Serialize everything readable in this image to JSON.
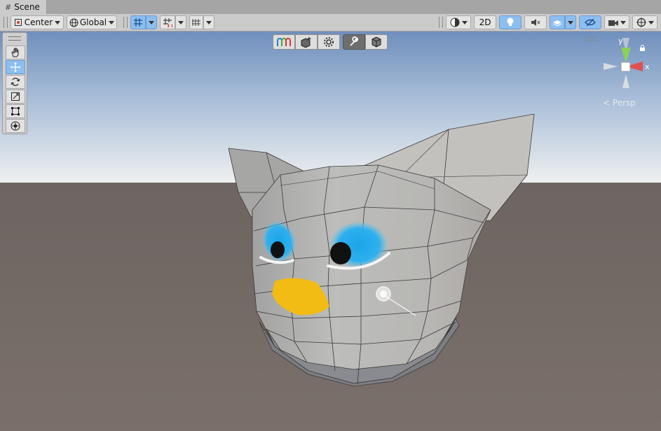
{
  "tab": {
    "title": "Scene"
  },
  "toolbar": {
    "pivot_label": "Center",
    "space_label": "Global",
    "mode_2d_label": "2D"
  },
  "gizmo": {
    "x_label": "x",
    "y_label": "y",
    "projection_label": "Persp"
  },
  "colors": {
    "accent": "#8cbef0",
    "x_axis": "#e05050",
    "y_axis": "#8ad05a"
  }
}
